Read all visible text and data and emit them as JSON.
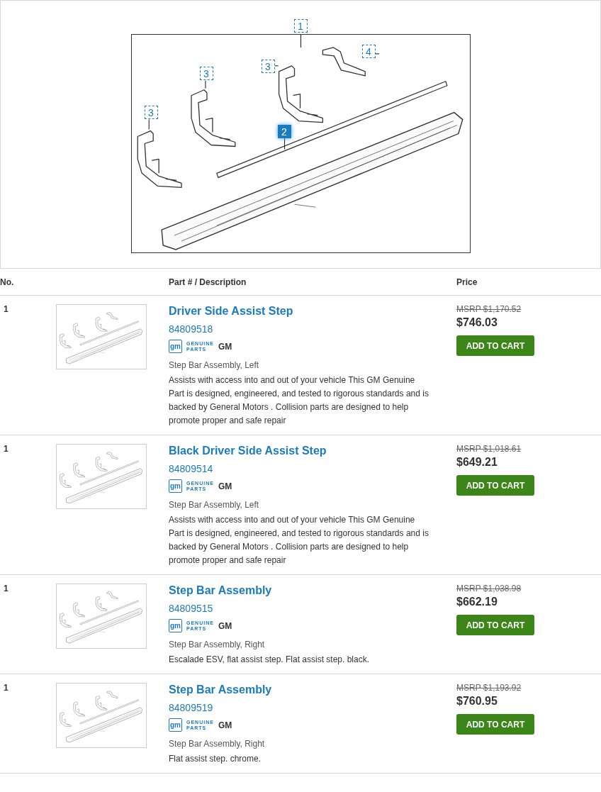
{
  "diagram": {
    "callouts": [
      {
        "label": "1",
        "selected": false
      },
      {
        "label": "3",
        "selected": false
      },
      {
        "label": "3",
        "selected": false
      },
      {
        "label": "3",
        "selected": false
      },
      {
        "label": "4",
        "selected": false
      },
      {
        "label": "2",
        "selected": true
      }
    ]
  },
  "table": {
    "columns": [
      "No.",
      "Part # / Description",
      "Price"
    ],
    "rows": [
      {
        "no": "1",
        "title": "Driver Side Assist Step",
        "part_number": "84809518",
        "logo_mark": "gm",
        "logo_line1": "GENUINE",
        "logo_line2": "PARTS",
        "brand": "GM",
        "subtitle": "Step Bar Assembly, Left",
        "description": "Assists with access into and out of your vehicle This GM Genuine Part is designed, engineered, and tested to rigorous standards and is backed by General Motors . Collision parts are designed to help promote proper and safe repair",
        "msrp": "MSRP $1,170.52",
        "price": "$746.03",
        "button": "ADD TO CART"
      },
      {
        "no": "1",
        "title": "Black Driver Side Assist Step",
        "part_number": "84809514",
        "logo_mark": "gm",
        "logo_line1": "GENUINE",
        "logo_line2": "PARTS",
        "brand": "GM",
        "subtitle": "Step Bar Assembly, Left",
        "description": "Assists with access into and out of your vehicle This GM Genuine Part is designed, engineered, and tested to rigorous standards and is backed by General Motors . Collision parts are designed to help promote proper and safe repair",
        "msrp": "MSRP $1,018.61",
        "price": "$649.21",
        "button": "ADD TO CART"
      },
      {
        "no": "1",
        "title": "Step Bar Assembly",
        "part_number": "84809515",
        "logo_mark": "gm",
        "logo_line1": "GENUINE",
        "logo_line2": "PARTS",
        "brand": "GM",
        "subtitle": "Step Bar Assembly, Right",
        "description": "Escalade ESV, flat assist step. Flat assist step. black.",
        "msrp": "MSRP $1,038.98",
        "price": "$662.19",
        "button": "ADD TO CART"
      },
      {
        "no": "1",
        "title": "Step Bar Assembly",
        "part_number": "84809519",
        "logo_mark": "gm",
        "logo_line1": "GENUINE",
        "logo_line2": "PARTS",
        "brand": "GM",
        "subtitle": "Step Bar Assembly, Right",
        "description": "Flat assist step. chrome.",
        "msrp": "MSRP $1,193.92",
        "price": "$760.95",
        "button": "ADD TO CART"
      }
    ]
  }
}
